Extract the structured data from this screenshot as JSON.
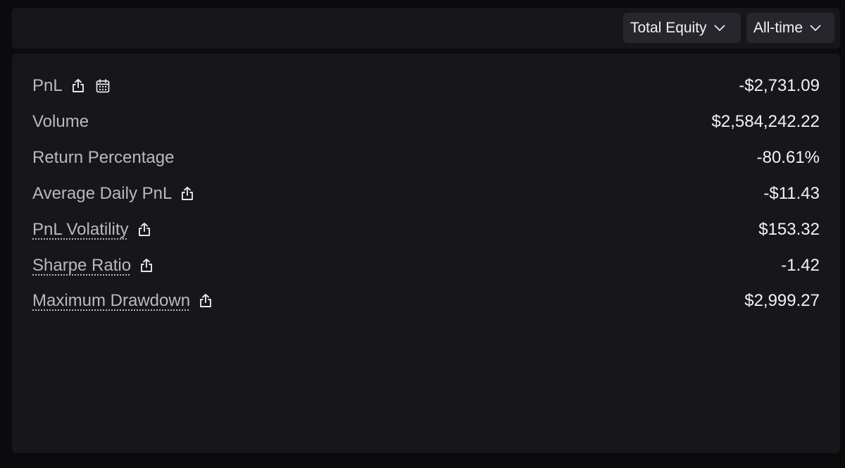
{
  "toolbar": {
    "metric_select": "Total Equity",
    "range_select": "All-time"
  },
  "stats": [
    {
      "label": "PnL",
      "value": "-$2,731.09",
      "icons": [
        "share-icon",
        "calendar-icon"
      ],
      "tooltip": false
    },
    {
      "label": "Volume",
      "value": "$2,584,242.22",
      "icons": [],
      "tooltip": false
    },
    {
      "label": "Return Percentage",
      "value": "-80.61%",
      "icons": [],
      "tooltip": false
    },
    {
      "label": "Average Daily PnL",
      "value": "-$11.43",
      "icons": [
        "share-icon"
      ],
      "tooltip": false
    },
    {
      "label": "PnL Volatility",
      "value": "$153.32",
      "icons": [
        "share-icon"
      ],
      "tooltip": true
    },
    {
      "label": "Sharpe Ratio",
      "value": "-1.42",
      "icons": [
        "share-icon"
      ],
      "tooltip": true
    },
    {
      "label": "Maximum Drawdown",
      "value": "$2,999.27",
      "icons": [
        "share-icon"
      ],
      "tooltip": true
    }
  ]
}
